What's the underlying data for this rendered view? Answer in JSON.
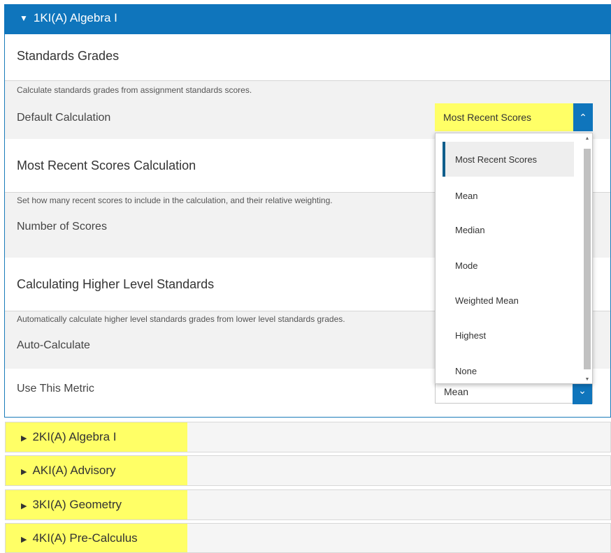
{
  "course": {
    "title": "1KI(A) Algebra I"
  },
  "standards_grades": {
    "title": "Standards Grades",
    "description": "Calculate standards grades from assignment standards scores.",
    "default_calc_label": "Default Calculation",
    "default_calc_value": "Most Recent Scores"
  },
  "most_recent": {
    "title": "Most Recent Scores Calculation",
    "description": "Set how many recent scores to include in the calculation, and their relative weighting.",
    "num_scores_label": "Number of Scores"
  },
  "higher_level": {
    "title": "Calculating Higher Level Standards",
    "description": "Automatically calculate higher level standards grades from lower level standards grades.",
    "auto_calc_label": "Auto-Calculate",
    "use_metric_label": "Use This Metric",
    "use_metric_value": "Mean"
  },
  "dropdown": {
    "options": [
      "Most Recent Scores",
      "Mean",
      "Median",
      "Mode",
      "Weighted Mean",
      "Highest",
      "None"
    ],
    "selected_index": 0
  },
  "collapsed_sections": [
    {
      "title": "2KI(A) Algebra I"
    },
    {
      "title": "AKI(A) Advisory"
    },
    {
      "title": "3KI(A) Geometry"
    },
    {
      "title": "4KI(A) Pre-Calculus"
    }
  ],
  "colors": {
    "header_blue": "#0f75bc",
    "highlight": "#ffff66"
  },
  "icons": {
    "expanded": "triangle-down-icon",
    "collapsed": "triangle-right-icon",
    "select_open": "chevron-up-icon"
  }
}
